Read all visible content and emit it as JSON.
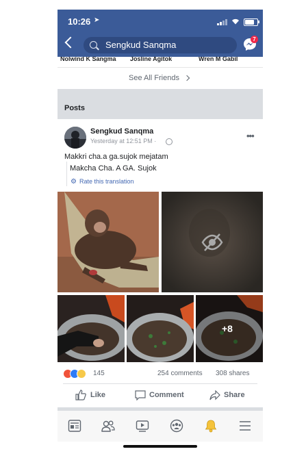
{
  "status": {
    "time": "10:26"
  },
  "header": {
    "search_text": "Sengkud Sanqma",
    "messenger_badge": "7"
  },
  "friends": {
    "names": [
      "Nolwind K Sangma",
      "Josline Agitok",
      "Wren M Gabil"
    ]
  },
  "see_all": {
    "label": "See All Friends"
  },
  "posts_section": {
    "label": "Posts"
  },
  "post": {
    "author": "Sengkud Sanqma",
    "timestamp": "Yesterday at 12:51 PM ·",
    "text": "Makkri cha.a ga.sujok mejatam",
    "translation": "Makcha Cha. A GA. Sujok",
    "rate_translation": "Rate this translation",
    "more_photos": "+8",
    "reaction_count": "145",
    "comments": "254 comments",
    "shares": "308 shares"
  },
  "actions": {
    "like": "Like",
    "comment": "Comment",
    "share": "Share"
  },
  "tabs": [
    "news-feed",
    "friends",
    "watch",
    "groups",
    "notifications",
    "menu"
  ],
  "colors": {
    "brand": "#3b5b98",
    "link": "#4267b2",
    "notification_bell": "#f5c33b"
  }
}
